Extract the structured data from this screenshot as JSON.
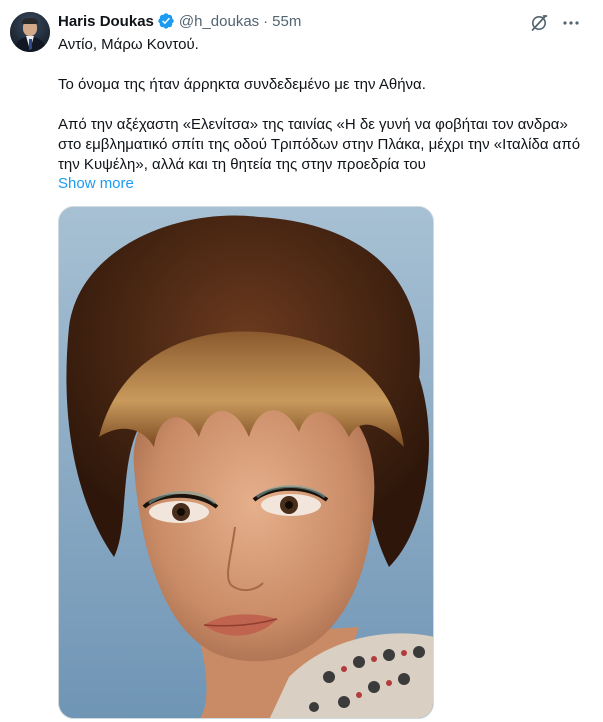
{
  "author": {
    "name": "Haris Doukas",
    "handle": "@h_doukas",
    "separator": "·",
    "time": "55m"
  },
  "tweet": {
    "paragraphs": [
      "Αντίο, Μάρω Κοντού.",
      "Το όνομα της ήταν άρρηκτα συνδεδεμένο με την Αθήνα.",
      "Από την αξέχαστη «Ελενίτσα» της ταινίας «Η δε γυνή να φοβήται τον ανδρα» στο εμβληματικό σπίτι της οδού Τριπόδων στην Πλάκα, μέχρι την «Ιταλίδα από την Κυψέλη», αλλά και τη θητεία της στην προεδρία του"
    ],
    "show_more": "Show more"
  },
  "icons": {
    "verified": "verified-badge-icon",
    "grok": "grok-icon",
    "more": "more-options-icon"
  },
  "colors": {
    "link": "#1d9bf0",
    "secondary_text": "#536471",
    "verified": "#1d9bf0"
  }
}
